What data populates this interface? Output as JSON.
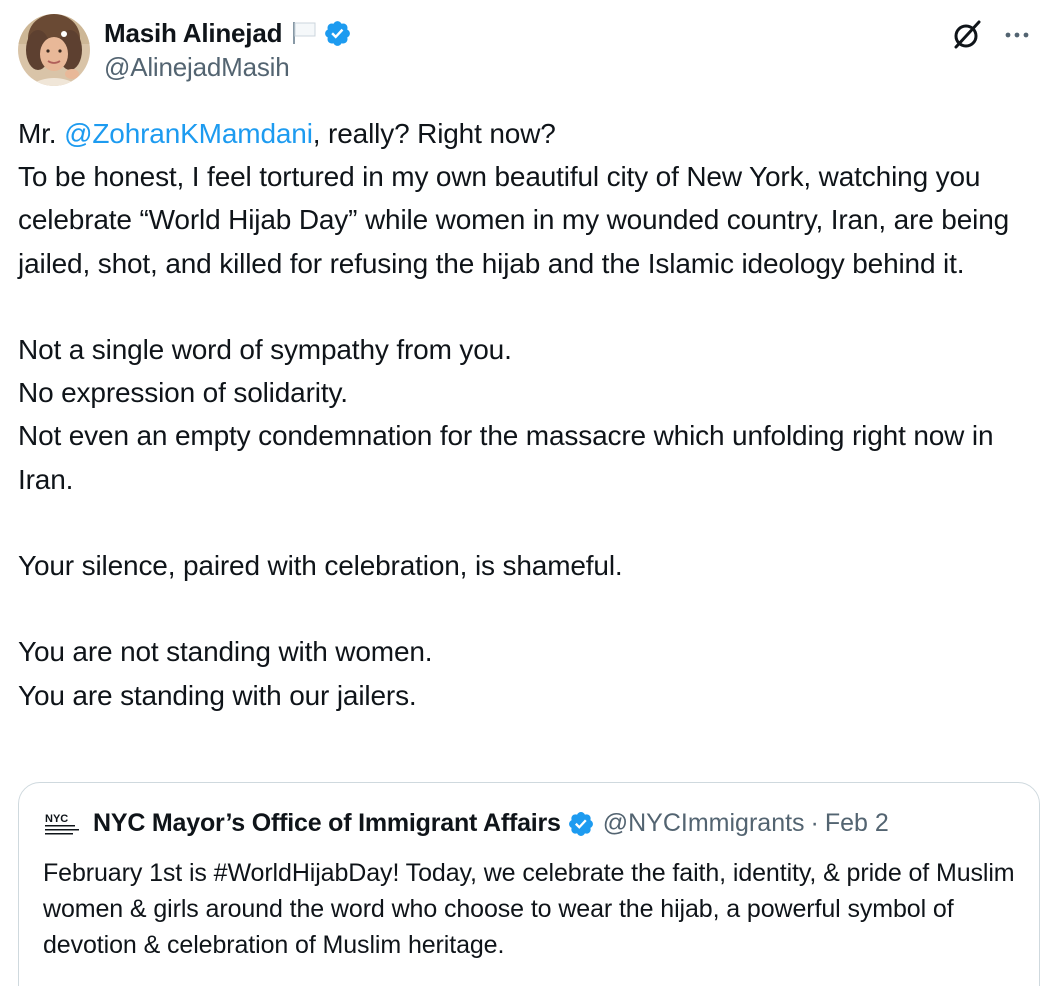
{
  "author": {
    "display_name": "Masih Alinejad",
    "flag_icon": "white-flag-icon",
    "verified_icon": "verified-badge-icon",
    "handle": "@AlinejadMasih"
  },
  "header_actions": {
    "grok_icon": "grok-icon",
    "more_icon": "more-options-icon"
  },
  "tweet": {
    "line1_prefix": "Mr. ",
    "line1_mention": "@ZohranKMamdani",
    "line1_suffix": ", really? Right now?",
    "para1_rest": "To be honest, I feel tortured in my own beautiful city of New York, watching you celebrate “World Hijab Day” while women in my wounded country, Iran, are being jailed, shot, and killed for refusing the hijab and the Islamic ideology behind it.",
    "para2_line1": "Not a single word of sympathy from you.",
    "para2_line2": "No expression of solidarity.",
    "para2_line3": "Not even an empty condemnation for the massacre which unfolding right now in Iran.",
    "para3": "Your silence, paired with celebration, is shameful.",
    "para4_line1": "You are not standing with women.",
    "para4_line2": "You are standing with our jailers."
  },
  "quoted_tweet": {
    "logo_icon": "nyc-logo-icon",
    "name": "NYC Mayor’s Office of Immigrant Affairs",
    "verified_icon": "verified-badge-icon",
    "handle": "@NYCImmigrants",
    "separator": "·",
    "date": "Feb 2",
    "text": "February 1st is #WorldHijabDay! Today, we celebrate the faith, identity, & pride of Muslim women & girls around the word who choose to wear the hijab, a powerful symbol of devotion & celebration of Muslim heritage."
  },
  "colors": {
    "text_primary": "#0f1419",
    "text_secondary": "#536471",
    "link": "#1d9bf0",
    "border": "#cfd9de"
  }
}
